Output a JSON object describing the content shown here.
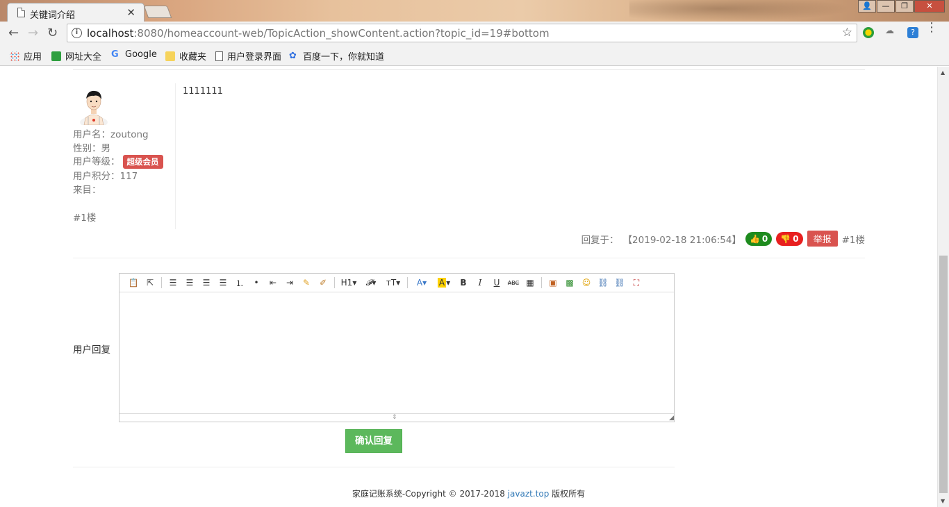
{
  "browser": {
    "tab_title": "关键词介绍",
    "url_host": "localhost",
    "url_rest": ":8080/homeaccount-web/TopicAction_showContent.action?topic_id=19#bottom",
    "bookmarks": [
      "应用",
      "网址大全",
      "Google",
      "收藏夹",
      "用户登录界面",
      "百度一下，你就知道"
    ]
  },
  "post": {
    "content": "1111111",
    "user": {
      "username": "用户名：zoutong",
      "gender": "性别：男",
      "level_label": "用户等级：",
      "level_badge": "超级会员",
      "points": "用户积分：117",
      "from": "来目：",
      "floor": "#1楼"
    },
    "reply_prefix": "回复于：",
    "reply_time": "【2019-02-18 21:06:54】",
    "likes": "0",
    "dislikes": "0",
    "report_label": "举报",
    "floor_tag": "#1楼"
  },
  "reply_form": {
    "label": "用户回复",
    "submit_label": "确认回复",
    "heading_button": "H1"
  },
  "footer": {
    "text": "家庭记账系统-Copyright © 2017-2018",
    "link": "javazt.top",
    "suffix": "版权所有"
  },
  "colors": {
    "report": "#d9534f",
    "like": "#1e8b1e",
    "dislike": "#e81f1f",
    "submit": "#5cb85c",
    "link": "#337ab7"
  }
}
